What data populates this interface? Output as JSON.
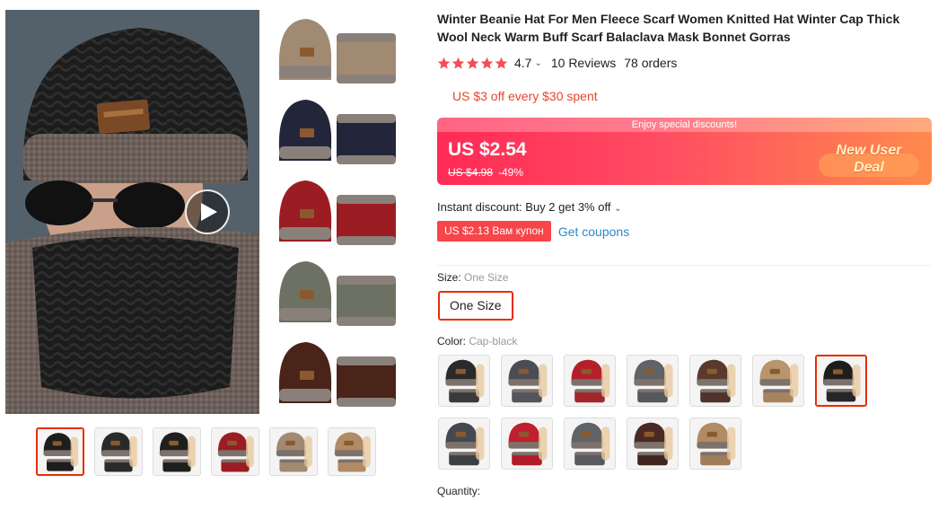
{
  "product": {
    "title": "Winter Beanie Hat For Men Fleece Scarf Women Knitted Hat Winter Cap Thick Wool Neck Warm Buff Scarf Balaclava Mask Bonnet Gorras",
    "rating_value": "4.7",
    "rating_stars": 5,
    "reviews": "10 Reviews",
    "orders": "78 orders"
  },
  "promo": {
    "store_discount": "US $3 off every $30 spent",
    "banner_header": "Enjoy special discounts!",
    "price": "US $2.54",
    "original_price": "US $4.98",
    "discount": "-49%",
    "deal_line1": "New User",
    "deal_line2": "Deal"
  },
  "discounts": {
    "instant": "Instant discount: Buy 2 get 3% off",
    "coupon_tag": "US $2.13 Вам купон",
    "get_coupons": "Get coupons"
  },
  "size": {
    "label": "Size: ",
    "selected": "One Size",
    "options": [
      "One Size"
    ]
  },
  "color": {
    "label": "Color: ",
    "selected": "Cap-black",
    "selected_index": 6,
    "swatches": [
      {
        "hat": "#2a2a2a",
        "scarf": "#3a3a3a"
      },
      {
        "hat": "#4a4d55",
        "scarf": "#52555c"
      },
      {
        "hat": "#b3202a",
        "scarf": "#a3252c"
      },
      {
        "hat": "#5f6266",
        "scarf": "#55585c"
      },
      {
        "hat": "#5a3a2c",
        "scarf": "#4e342a"
      },
      {
        "hat": "#b8956c",
        "scarf": "#a8845e"
      },
      {
        "hat": "#1d1d1d",
        "scarf": "#262626"
      },
      {
        "hat": "#454850",
        "scarf": "#3c3f46"
      },
      {
        "hat": "#c01f2e",
        "scarf": "#b11c29"
      },
      {
        "hat": "#606366",
        "scarf": "#575a5e"
      },
      {
        "hat": "#4b2a24",
        "scarf": "#40251f"
      },
      {
        "hat": "#b08b66",
        "scarf": "#a17d5a"
      }
    ]
  },
  "quantity": {
    "label": "Quantity:"
  },
  "gallery": {
    "active_index": 0,
    "thumbnail_count": 6,
    "collage_colors": [
      "#a08a72",
      "#23263a",
      "#9b1c22",
      "#6c7163",
      "#4a2419"
    ]
  },
  "colors": {
    "accent": "#e62e04",
    "price_gradient_start": "#ff2a55",
    "price_gradient_end": "#ff8a4c",
    "link": "#2e88c7",
    "star": "#f44e58"
  },
  "icons": {
    "play": "play-icon",
    "star": "star-icon",
    "chevron": "chevron-down-icon"
  }
}
